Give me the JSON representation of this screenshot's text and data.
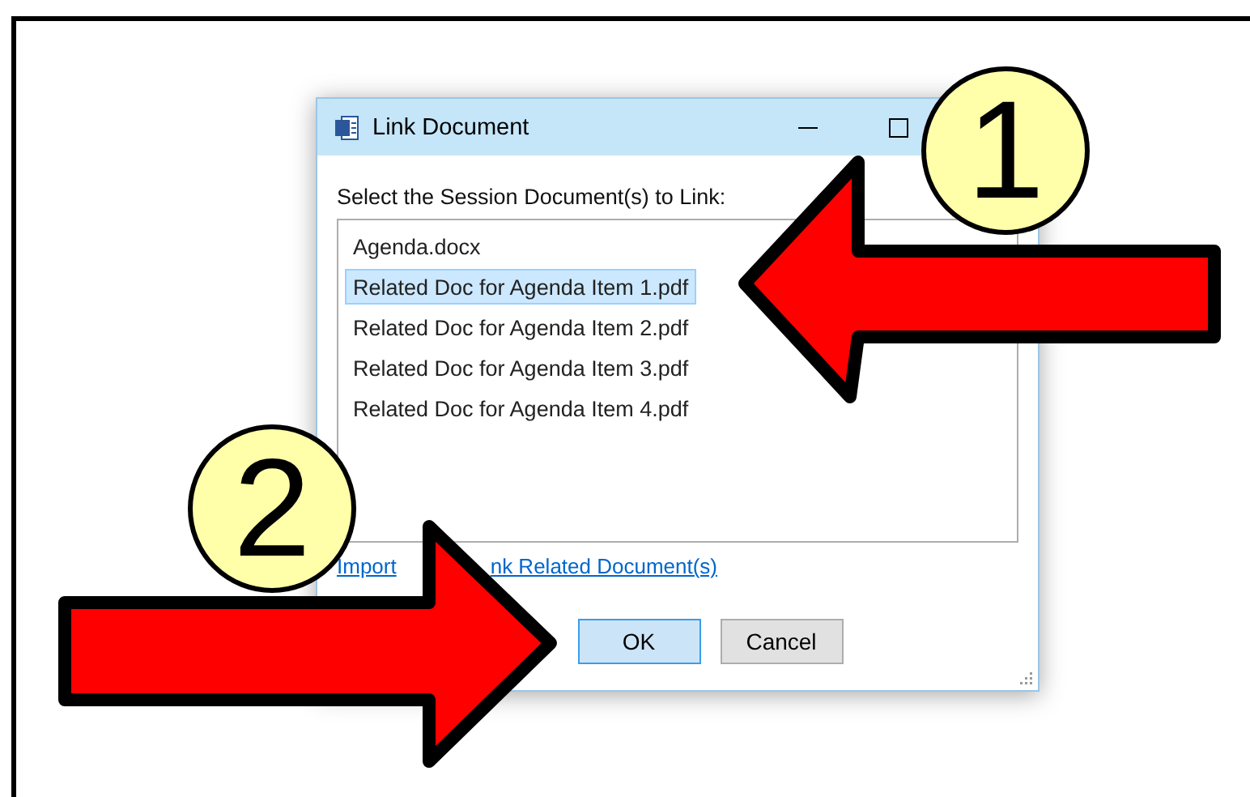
{
  "window": {
    "title": "Link Document"
  },
  "prompt": "Select the Session Document(s) to Link:",
  "documents": [
    {
      "name": "Agenda.docx",
      "selected": false
    },
    {
      "name": "Related Doc for Agenda Item 1.pdf",
      "selected": true
    },
    {
      "name": "Related Doc for Agenda Item 2.pdf",
      "selected": false
    },
    {
      "name": "Related Doc for Agenda Item 3.pdf",
      "selected": false
    },
    {
      "name": "Related Doc for Agenda Item 4.pdf",
      "selected": false
    }
  ],
  "link_parts": [
    "Import",
    "nk Related Document(s)"
  ],
  "buttons": [
    {
      "label": "OK",
      "kind": "default"
    },
    {
      "label": "Cancel",
      "kind": "normal"
    }
  ],
  "callouts": [
    {
      "number": "1",
      "kind": "left"
    },
    {
      "number": "2",
      "kind": "right"
    }
  ]
}
